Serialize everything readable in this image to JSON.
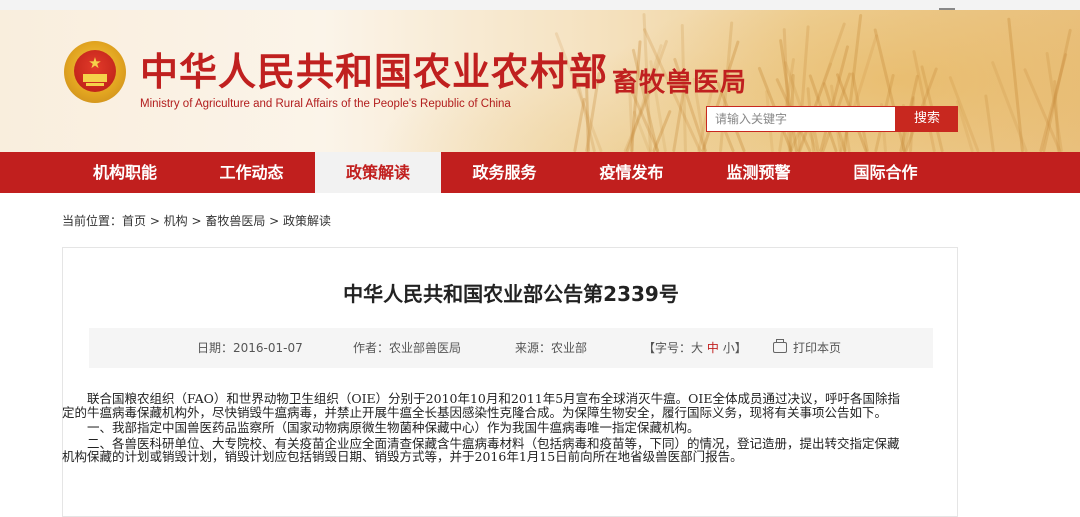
{
  "header": {
    "site_title": "中华人民共和国农业农村部",
    "site_subtitle": "Ministry of Agriculture and Rural Affairs of the People's Republic of China",
    "department": "畜牧兽医局",
    "search_placeholder": "请输入关键字",
    "search_button": "搜索",
    "emblem_icon": "national-emblem"
  },
  "nav": {
    "active_index": 2,
    "items": [
      {
        "label": "机构职能"
      },
      {
        "label": "工作动态"
      },
      {
        "label": "政策解读"
      },
      {
        "label": "政务服务"
      },
      {
        "label": "疫情发布"
      },
      {
        "label": "监测预警"
      },
      {
        "label": "国际合作"
      }
    ]
  },
  "breadcrumb": "当前位置：首页 > 机构 > 畜牧兽医局 > 政策解读",
  "article": {
    "title": "中华人民共和国农业部公告第2339号",
    "meta": {
      "date": "日期：2016-01-07",
      "author": "作者：农业部兽医局",
      "source": "来源：农业部",
      "font_size_prefix": "【字号：",
      "font_large": "大",
      "font_medium": "中",
      "font_small": "小",
      "font_size_suffix": "】",
      "print": "打印本页"
    },
    "paragraphs": [
      "联合国粮农组织（FAO）和世界动物卫生组织（OIE）分别于2010年10月和2011年5月宣布全球消灭牛瘟。OIE全体成员通过决议，呼吁各国除指定的牛瘟病毒保藏机构外，尽快销毁牛瘟病毒，并禁止开展牛瘟全长基因感染性克隆合成。为保障生物安全，履行国际义务，现将有关事项公告如下。",
      "一、我部指定中国兽医药品监察所（国家动物病原微生物菌种保藏中心）作为我国牛瘟病毒唯一指定保藏机构。",
      "二、各兽医科研单位、大专院校、有关疫苗企业应全面清查保藏含牛瘟病毒材料（包括病毒和疫苗等，下同）的情况，登记造册，提出转交指定保藏机构保藏的计划或销毁计划，销毁计划应包括销毁日期、销毁方式等，并于2016年1月15日前向所在地省级兽医部门报告。"
    ]
  },
  "colors": {
    "brand_red": "#c11f1e",
    "active_tab_bg": "#f2f2f2"
  }
}
